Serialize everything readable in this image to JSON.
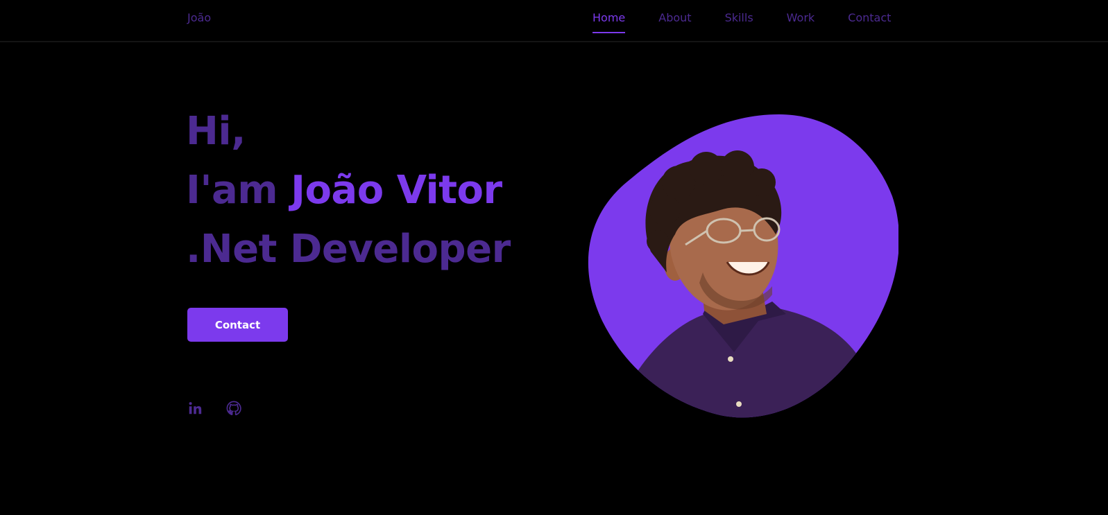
{
  "header": {
    "logo": "João",
    "nav": [
      {
        "label": "Home",
        "active": true
      },
      {
        "label": "About",
        "active": false
      },
      {
        "label": "Skills",
        "active": false
      },
      {
        "label": "Work",
        "active": false
      },
      {
        "label": "Contact",
        "active": false
      }
    ]
  },
  "hero": {
    "line1": "Hi,",
    "line2_prefix": "I'am ",
    "line2_name": "João Vitor",
    "line3": ".Net Developer",
    "cta_label": "Contact"
  },
  "social": [
    {
      "icon": "linkedin-icon"
    },
    {
      "icon": "github-icon"
    }
  ],
  "colors": {
    "accent": "#7c3aed",
    "muted_accent": "#4c2a91",
    "background": "#000000",
    "shirt": "#3b2157",
    "skin": "#a86a4c",
    "hair": "#2a1a14"
  }
}
